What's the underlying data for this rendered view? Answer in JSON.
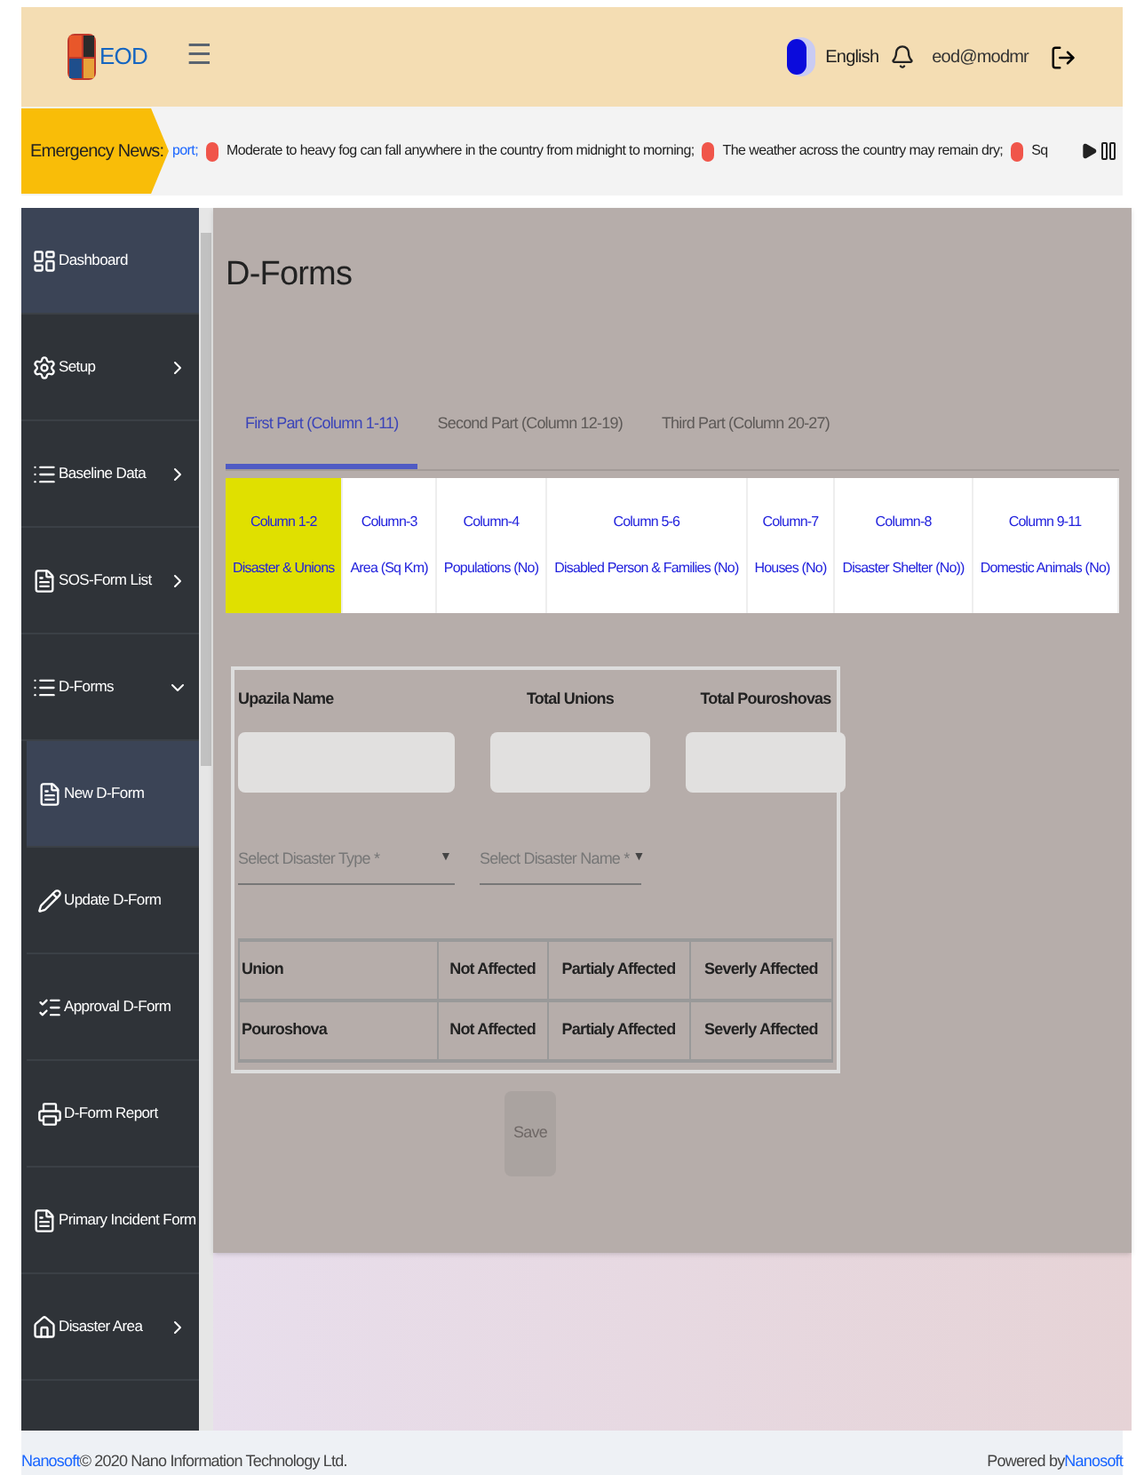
{
  "header": {
    "logo_text": "EOD",
    "menu_glyph": "☰",
    "language": "English",
    "user": "eod@modmr"
  },
  "news": {
    "label": "Emergency News:",
    "items": [
      {
        "text": "port;",
        "kind": "link"
      },
      {
        "text": "Moderate to heavy fog can fall anywhere in the country from midnight to morning;",
        "kind": "plain"
      },
      {
        "text": "The weather across the country may remain dry;",
        "kind": "plain"
      },
      {
        "text": "Sq",
        "kind": "plain"
      }
    ]
  },
  "sidebar": {
    "items": [
      {
        "label": "Dashboard",
        "kind": "link",
        "selected": true
      },
      {
        "label": "Setup",
        "kind": "group",
        "expanded": false,
        "selected": false
      },
      {
        "label": "Baseline Data",
        "kind": "group",
        "expanded": false,
        "selected": false
      },
      {
        "label": "SOS-Form List",
        "kind": "group",
        "expanded": false,
        "selected": false
      },
      {
        "label": "D-Forms",
        "kind": "group",
        "expanded": true,
        "selected": false,
        "children": [
          {
            "label": "New D-Form",
            "selected": true
          },
          {
            "label": "Update D-Form",
            "selected": false
          },
          {
            "label": "Approval D-Form",
            "selected": false
          },
          {
            "label": "D-Form Report",
            "selected": false
          }
        ]
      },
      {
        "label": "Primary Incident Form",
        "kind": "link",
        "selected": false
      },
      {
        "label": "Disaster Area",
        "kind": "group",
        "expanded": false,
        "selected": false
      }
    ]
  },
  "page": {
    "title": "D-Forms",
    "parts": [
      {
        "label": "First Part (Column 1-11)",
        "selected": true
      },
      {
        "label": "Second Part (Column 12-19)",
        "selected": false
      },
      {
        "label": "Third Part (Column 20-27)",
        "selected": false
      }
    ],
    "column_tabs": [
      {
        "top": "Column 1-2",
        "bottom": "Disaster & Unions",
        "selected": true
      },
      {
        "top": "Column-3",
        "bottom": "Area (Sq Km)",
        "selected": false
      },
      {
        "top": "Column-4",
        "bottom": "Populations (No)",
        "selected": false
      },
      {
        "top": "Column 5-6",
        "bottom": "Disabled Person & Families (No)",
        "selected": false
      },
      {
        "top": "Column-7",
        "bottom": "Houses (No)",
        "selected": false
      },
      {
        "top": "Column-8",
        "bottom": "Disaster Shelter (No))",
        "selected": false
      },
      {
        "top": "Column 9-11",
        "bottom": "Domestic Animals (No)",
        "selected": false
      }
    ],
    "fields": [
      {
        "label": "Upazila Name"
      },
      {
        "label": "Total Unions"
      },
      {
        "label": "Total Pouroshovas"
      }
    ],
    "selects": [
      {
        "placeholder": "Select Disaster Type *",
        "caret": "▼"
      },
      {
        "placeholder": "Select Disaster Name *",
        "caret": "▼"
      }
    ],
    "table": {
      "rows": [
        [
          "Union",
          "Not Affected",
          "Partialy Affected",
          "Severly Affected"
        ],
        [
          "Pouroshova",
          "Not Affected",
          "Partialy Affected",
          "Severly Affected"
        ]
      ]
    },
    "save_button": {
      "label": "Save",
      "disabled": true
    }
  },
  "footer": {
    "left_link": "Nanosoft",
    "left_text": "© 2020 Nano Information Technology Ltd.",
    "right_text": "Powered by",
    "right_link": "Nanosoft"
  }
}
